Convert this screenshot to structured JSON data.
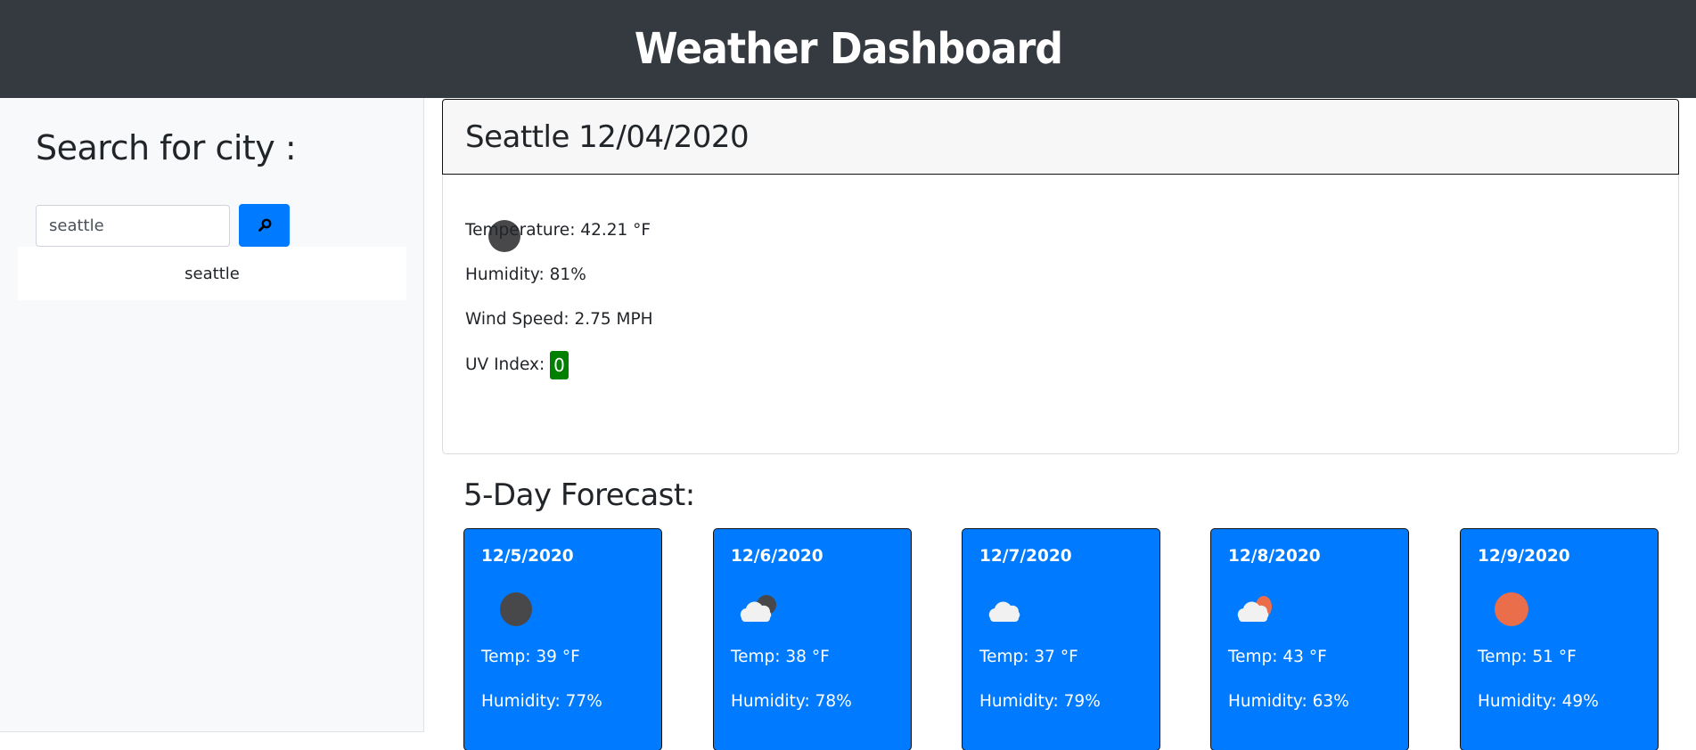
{
  "header": {
    "title": "Weather Dashboard"
  },
  "sidebar": {
    "heading": "Search for city :",
    "search_input_value": "seattle",
    "search_button_icon": "search-icon",
    "history": [
      {
        "label": "seattle"
      }
    ]
  },
  "current": {
    "title": "Seattle 12/04/2020",
    "icon": "night-clear-icon",
    "temperature": "Temperature: 42.21 °F",
    "humidity": "Humidity: 81%",
    "wind": "Wind Speed: 2.75 MPH",
    "uv_label": "UV Index:",
    "uv_value": "0",
    "uv_color": "#008000"
  },
  "forecast": {
    "title": "5-Day Forecast:",
    "days": [
      {
        "date": "12/5/2020",
        "icon": "night-clear-icon",
        "temp": "Temp: 39 °F",
        "humidity": "Humidity: 77%"
      },
      {
        "date": "12/6/2020",
        "icon": "night-partly-cloudy-icon",
        "temp": "Temp: 38 °F",
        "humidity": "Humidity: 78%"
      },
      {
        "date": "12/7/2020",
        "icon": "cloud-icon",
        "temp": "Temp: 37 °F",
        "humidity": "Humidity: 79%"
      },
      {
        "date": "12/8/2020",
        "icon": "day-partly-cloudy-icon",
        "temp": "Temp: 43 °F",
        "humidity": "Humidity: 63%"
      },
      {
        "date": "12/9/2020",
        "icon": "sun-icon",
        "temp": "Temp: 51 °F",
        "humidity": "Humidity: 49%"
      }
    ]
  },
  "colors": {
    "header_bg": "#343a40",
    "accent_blue": "#007bff",
    "sidebar_bg": "#f8f9fa",
    "moon": "#48484a",
    "sun": "#eb6e4b",
    "cloud": "#f1f1f1"
  }
}
